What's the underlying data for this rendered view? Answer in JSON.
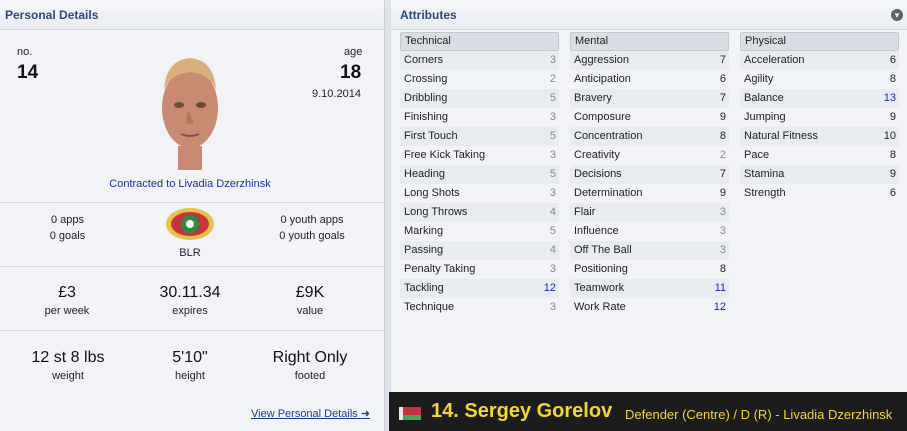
{
  "personal": {
    "title": "Personal Details",
    "no_label": "no.",
    "no": "14",
    "age_label": "age",
    "age": "18",
    "dob": "9.10.2014",
    "contract": "Contracted to Livadia Dzerzhinsk",
    "apps": "0 apps",
    "goals": "0 goals",
    "nation": "BLR",
    "youth_apps": "0 youth apps",
    "youth_goals": "0 youth goals",
    "wage": "£3",
    "wage_label": "per week",
    "expires": "30.11.34",
    "expires_label": "expires",
    "value": "£9K",
    "value_label": "value",
    "weight": "12 st 8 lbs",
    "weight_label": "weight",
    "height": "5'10\"",
    "height_label": "height",
    "footed": "Right Only",
    "footed_label": "footed",
    "view_link": "View Personal Details ➜"
  },
  "attributes": {
    "title": "Attributes",
    "technical": {
      "label": "Technical",
      "items": [
        {
          "name": "Corners",
          "value": "3"
        },
        {
          "name": "Crossing",
          "value": "2"
        },
        {
          "name": "Dribbling",
          "value": "5"
        },
        {
          "name": "Finishing",
          "value": "3"
        },
        {
          "name": "First Touch",
          "value": "5"
        },
        {
          "name": "Free Kick Taking",
          "value": "3"
        },
        {
          "name": "Heading",
          "value": "5"
        },
        {
          "name": "Long Shots",
          "value": "3"
        },
        {
          "name": "Long Throws",
          "value": "4"
        },
        {
          "name": "Marking",
          "value": "5"
        },
        {
          "name": "Passing",
          "value": "4"
        },
        {
          "name": "Penalty Taking",
          "value": "3"
        },
        {
          "name": "Tackling",
          "value": "12"
        },
        {
          "name": "Technique",
          "value": "3"
        }
      ]
    },
    "mental": {
      "label": "Mental",
      "items": [
        {
          "name": "Aggression",
          "value": "7"
        },
        {
          "name": "Anticipation",
          "value": "6"
        },
        {
          "name": "Bravery",
          "value": "7"
        },
        {
          "name": "Composure",
          "value": "9"
        },
        {
          "name": "Concentration",
          "value": "8"
        },
        {
          "name": "Creativity",
          "value": "2"
        },
        {
          "name": "Decisions",
          "value": "7"
        },
        {
          "name": "Determination",
          "value": "9"
        },
        {
          "name": "Flair",
          "value": "3"
        },
        {
          "name": "Influence",
          "value": "3"
        },
        {
          "name": "Off The Ball",
          "value": "3"
        },
        {
          "name": "Positioning",
          "value": "8"
        },
        {
          "name": "Teamwork",
          "value": "11"
        },
        {
          "name": "Work Rate",
          "value": "12"
        }
      ]
    },
    "physical": {
      "label": "Physical",
      "items": [
        {
          "name": "Acceleration",
          "value": "6"
        },
        {
          "name": "Agility",
          "value": "8"
        },
        {
          "name": "Balance",
          "value": "13"
        },
        {
          "name": "Jumping",
          "value": "9"
        },
        {
          "name": "Natural Fitness",
          "value": "10"
        },
        {
          "name": "Pace",
          "value": "8"
        },
        {
          "name": "Stamina",
          "value": "9"
        },
        {
          "name": "Strength",
          "value": "6"
        }
      ]
    }
  },
  "player": {
    "name": "14. Sergey Gorelov",
    "position": "Defender (Centre) / D (R) - Livadia Dzerzhinsk"
  },
  "colors": {
    "accent": "#f2d53a",
    "link": "#1d3b8c",
    "highlight": "#1a2a9a"
  }
}
